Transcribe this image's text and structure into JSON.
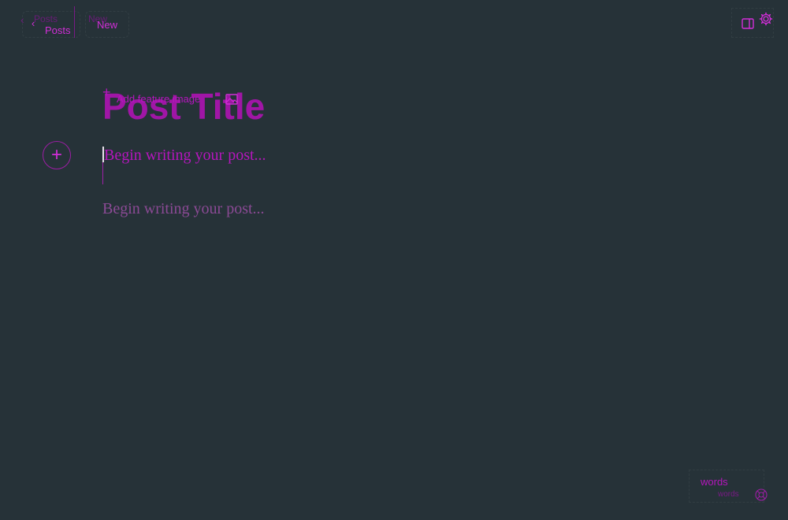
{
  "header": {
    "back_ghost_label": "Posts",
    "back_label": "Posts",
    "status_ghost_label": "New",
    "status_label": "New"
  },
  "editor": {
    "feature_image_label": "Add feature image",
    "title": "Post Title",
    "body_placeholder": "Begin writing your post...",
    "body_placeholder_ghost": "Begin writing your post..."
  },
  "footer": {
    "word_count_label": "words",
    "word_count_ghost": "words"
  },
  "icons": {
    "back": "chevron-left-icon",
    "sidebar_toggle": "sidebar-icon",
    "settings": "gear-icon",
    "add_card": "plus-icon",
    "feature_image": "image-icon",
    "help": "help-icon"
  },
  "colors": {
    "background": "#263238",
    "accent": "#d22ed8",
    "text": "#a016a6"
  }
}
